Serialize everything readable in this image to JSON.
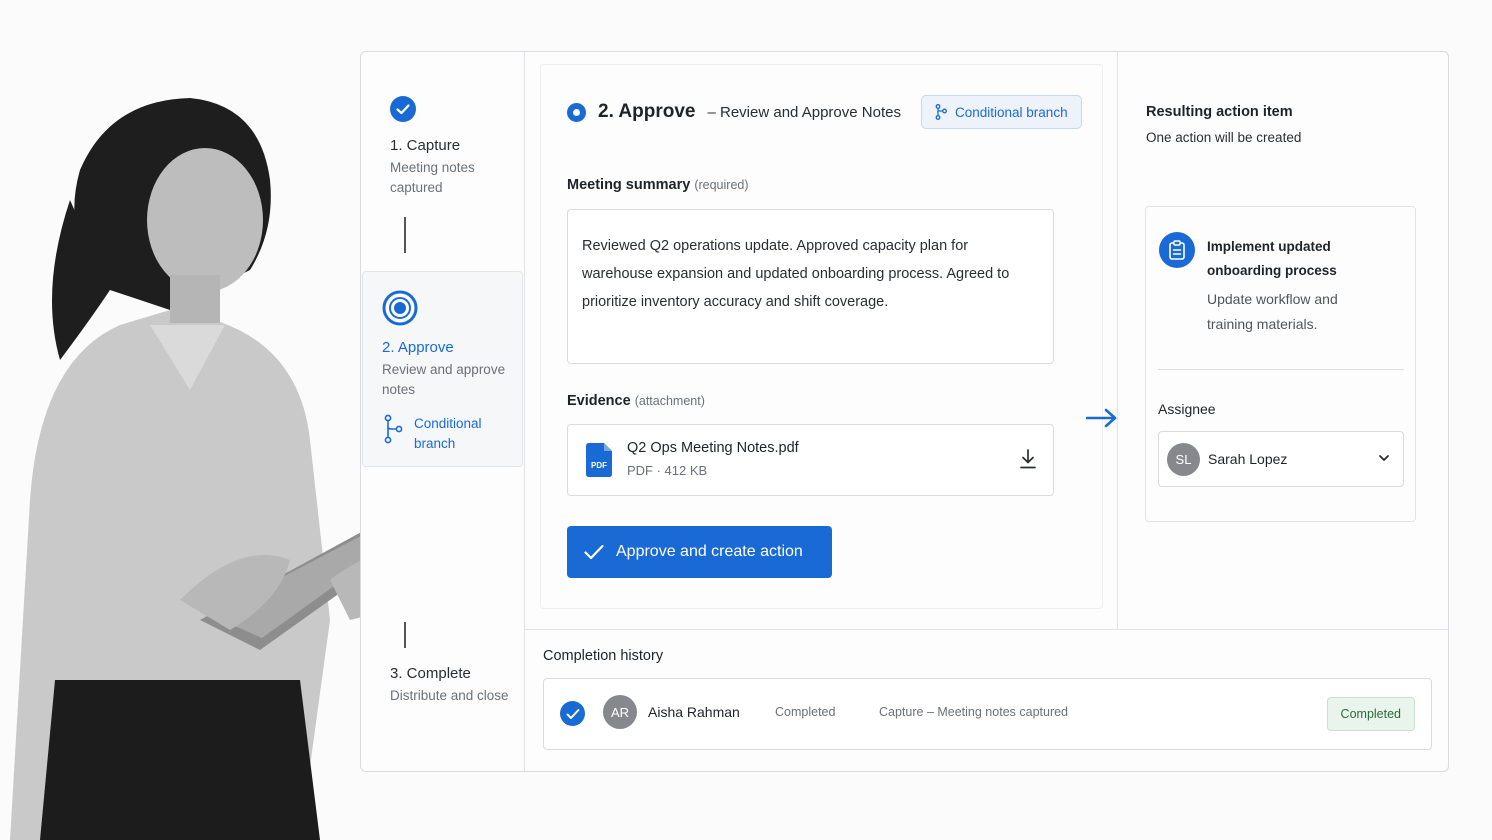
{
  "stepper": {
    "steps": [
      {
        "title": "1.  Capture",
        "subtitle": "Meeting notes captured",
        "state": "done"
      },
      {
        "title": "2.  Approve",
        "subtitle": "Review and approve notes",
        "state": "active",
        "branch_label": "Conditional branch"
      },
      {
        "title": "3.  Complete",
        "subtitle": "Distribute and close",
        "state": "pending"
      }
    ]
  },
  "approve_panel": {
    "title": "2. Approve",
    "subtitle": "– Review and Approve Notes",
    "branch_chip": "Conditional branch",
    "summary_label": "Meeting summary",
    "summary_hint": "(required)",
    "summary_text": "Reviewed Q2 operations update. Approved capacity plan for warehouse expansion and updated onboarding process. Agreed to prioritize inventory accuracy and shift coverage.",
    "evidence_label": "Evidence",
    "evidence_hint": "(attachment)",
    "file": {
      "icon_text": "PDF",
      "name": "Q2 Ops Meeting Notes.pdf",
      "meta": "PDF · 412 KB"
    },
    "approve_button": "Approve and create action"
  },
  "result": {
    "title": "Resulting action item",
    "subtitle": "One action will be created",
    "action_name": "Implement updated onboarding process",
    "action_desc": "Update workflow and training materials.",
    "assignee_label": "Assignee",
    "assignee_initials": "SL",
    "assignee_name": "Sarah Lopez"
  },
  "history": {
    "title": "Completion history",
    "rows": [
      {
        "initials": "AR",
        "name": "Aisha Rahman",
        "action": "Completed",
        "step": "Capture – Meeting notes captured",
        "status": "Completed"
      }
    ]
  },
  "colors": {
    "accent": "#1a6ad6",
    "success_bg": "#e9f4ec",
    "success_text": "#2c6b3d"
  }
}
